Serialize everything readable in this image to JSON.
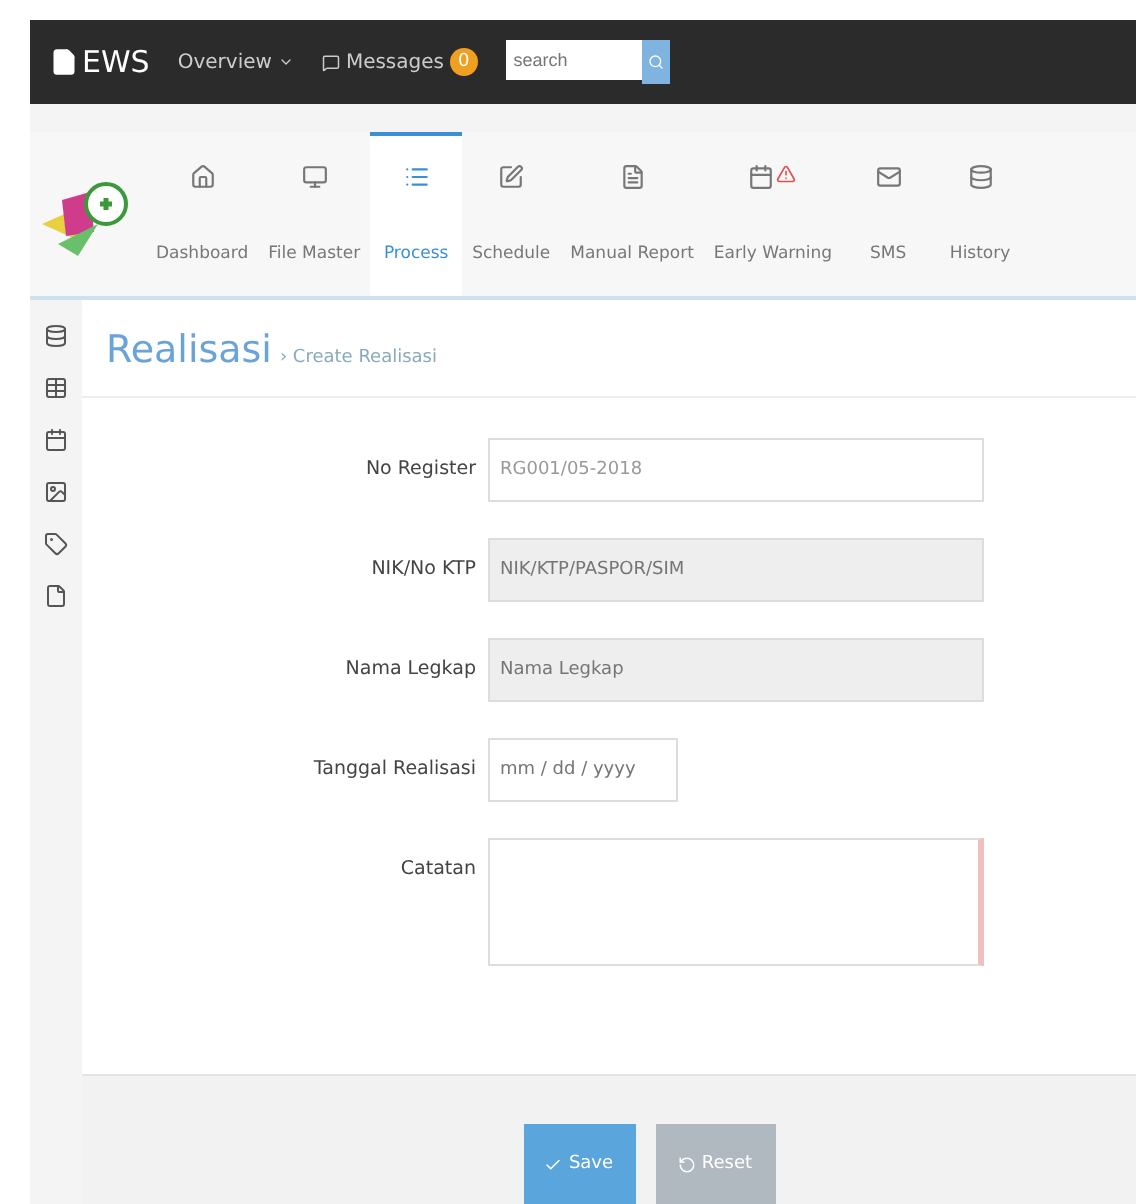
{
  "navbar": {
    "brand": "EWS",
    "overview": "Overview",
    "messages": "Messages",
    "message_count": "0",
    "search": {
      "placeholder": "search"
    }
  },
  "menu": [
    {
      "label": "Dashboard",
      "selected": false
    },
    {
      "label": "File Master",
      "selected": false
    },
    {
      "label": "Process",
      "selected": true
    },
    {
      "label": "Schedule",
      "selected": false
    },
    {
      "label": "Manual Report",
      "selected": false
    },
    {
      "label": "Early Warning",
      "selected": false
    },
    {
      "label": "SMS",
      "selected": false
    },
    {
      "label": "History",
      "selected": false
    }
  ],
  "page": {
    "title": "Realisasi",
    "breadcrumb": "› Create Realisasi"
  },
  "form": [
    {
      "label": "No Register",
      "value": "RG001/05-2018",
      "kind": "text",
      "disabled": false
    },
    {
      "label": "NIK/No KTP",
      "placeholder": "NIK/KTP/PASPOR/SIM",
      "kind": "text",
      "disabled": true
    },
    {
      "label": "Nama Legkap",
      "placeholder": "Nama Legkap",
      "kind": "text",
      "disabled": true
    },
    {
      "label": "Tanggal Realisasi",
      "placeholder": "mm / dd / yyyy",
      "kind": "date",
      "disabled": false
    },
    {
      "label": "Catatan",
      "kind": "textarea"
    }
  ],
  "buttons": [
    {
      "label": "Save",
      "kind": "primary"
    },
    {
      "label": "Reset",
      "kind": "secondary"
    }
  ]
}
